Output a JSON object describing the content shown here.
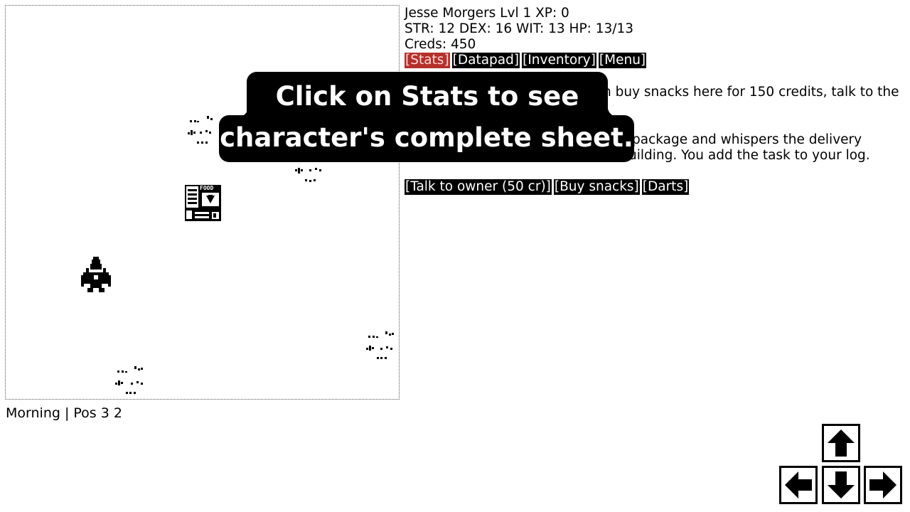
{
  "player": {
    "line1": "Jesse Morgers Lvl 1 XP: 0",
    "line2": "STR: 12 DEX: 16 WIT: 13 HP: 13/13",
    "line3": "Creds: 450"
  },
  "menu": {
    "stats": "[Stats]",
    "datapad": "[Datapad]",
    "inventory": "[Inventory]",
    "menu": "[Menu]"
  },
  "narrative": {
    "frag1": "n buy snacks here for 150 credits, talk to the",
    "frag2": "package and whispers the delivery",
    "frag3": "uilding. You add the task to your log."
  },
  "actions": {
    "talk": "[Talk to owner (50 cr)]",
    "snacks": "[Buy snacks]",
    "darts": "[Darts]"
  },
  "status": "Morning | Pos 3 2",
  "building_sign": "FOOD",
  "tooltip": {
    "line1": "Click on Stats to see the",
    "line2": "character's complete sheet."
  },
  "colors": {
    "active_button": "#b5302b",
    "button_bg": "#000000"
  },
  "icons": [
    "ship-icon",
    "building-icon",
    "asteroid-icon",
    "arrow-up-icon",
    "arrow-left-icon",
    "arrow-down-icon",
    "arrow-right-icon"
  ]
}
